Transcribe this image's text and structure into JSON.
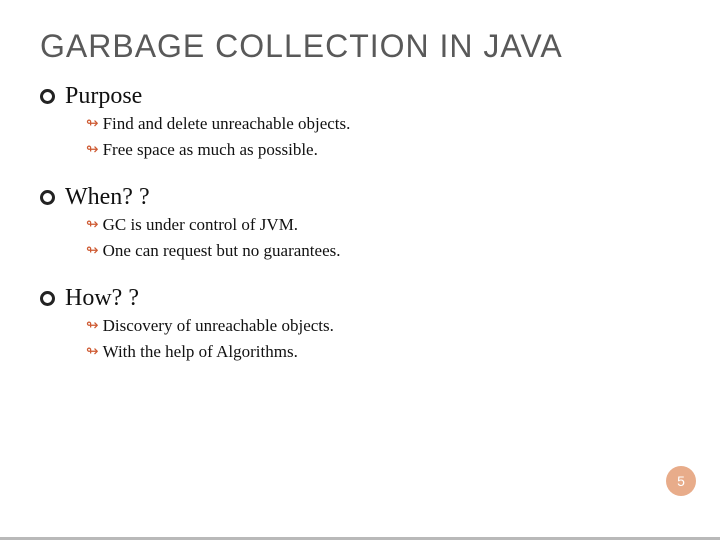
{
  "title": "GARBAGE COLLECTION IN JAVA",
  "sections": [
    {
      "heading": "Purpose",
      "items": [
        "Find and delete unreachable objects.",
        "Free space as much as possible."
      ]
    },
    {
      "heading": "When? ?",
      "items": [
        "GC is under control of JVM.",
        "One can request but no guarantees."
      ]
    },
    {
      "heading": "How? ?",
      "items": [
        "Discovery of unreachable objects.",
        "With the help of Algorithms."
      ]
    }
  ],
  "pageNumber": "5"
}
